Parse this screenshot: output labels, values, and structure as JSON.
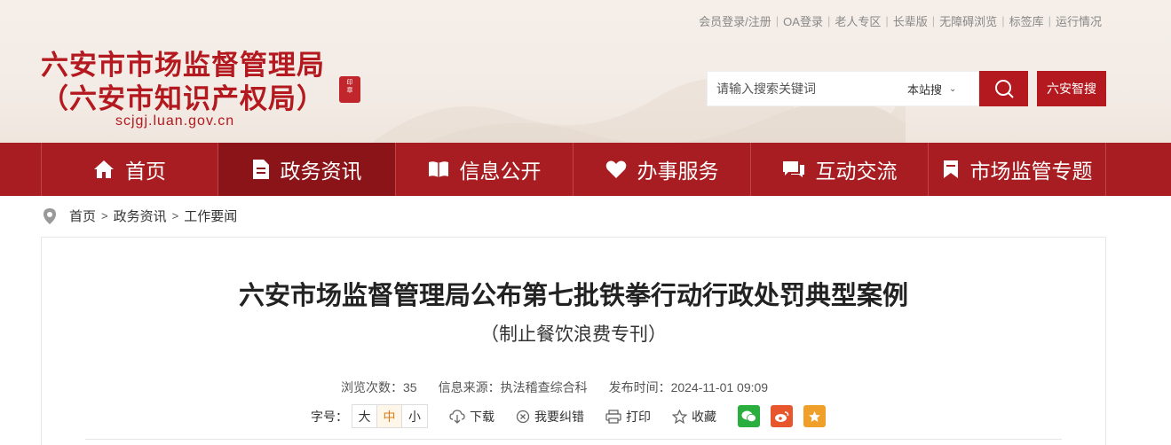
{
  "header": {
    "title_line1": "六安市市场监督管理局",
    "title_line2": "（六安市知识产权局）",
    "domain": "scjgj.luan.gov.cn",
    "top_links": [
      "会员登录/注册",
      "OA登录",
      "老人专区",
      "长辈版",
      "无障碍浏览",
      "标签库",
      "运行情况"
    ]
  },
  "search": {
    "placeholder": "请输入搜索关键词",
    "scope": "本站搜",
    "zhisou_label": "六安智搜"
  },
  "nav": {
    "items": [
      {
        "label": "首页",
        "icon": "home-icon"
      },
      {
        "label": "政务资讯",
        "icon": "document-icon",
        "active": true
      },
      {
        "label": "信息公开",
        "icon": "open-book-icon"
      },
      {
        "label": "办事服务",
        "icon": "heart-icon"
      },
      {
        "label": "互动交流",
        "icon": "chat-icon"
      },
      {
        "label": "市场监管专题",
        "icon": "bookmark-icon"
      }
    ]
  },
  "breadcrumb": [
    "首页",
    "政务资讯",
    "工作要闻"
  ],
  "article": {
    "title": "六安市场监督管理局公布第七批铁拳行动行政处罚典型案例",
    "subtitle": "（制止餐饮浪费专刊）",
    "views": "浏览次数：35",
    "source": "信息来源：执法稽查综合科",
    "published": "发布时间：2024-11-01 09:09",
    "font_size_label": "字号：",
    "font_sizes": [
      "大",
      "中",
      "小"
    ],
    "font_size_selected": "中",
    "tools": {
      "download": "下载",
      "report_error": "我要纠错",
      "print": "打印",
      "favorite": "收藏"
    }
  },
  "colors": {
    "brand_red": "#b3191e",
    "nav_red": "#a71d22",
    "nav_active": "#8a1418",
    "wechat": "#2aae3e",
    "weibo": "#e8562e",
    "qzone": "#f0a02a"
  }
}
